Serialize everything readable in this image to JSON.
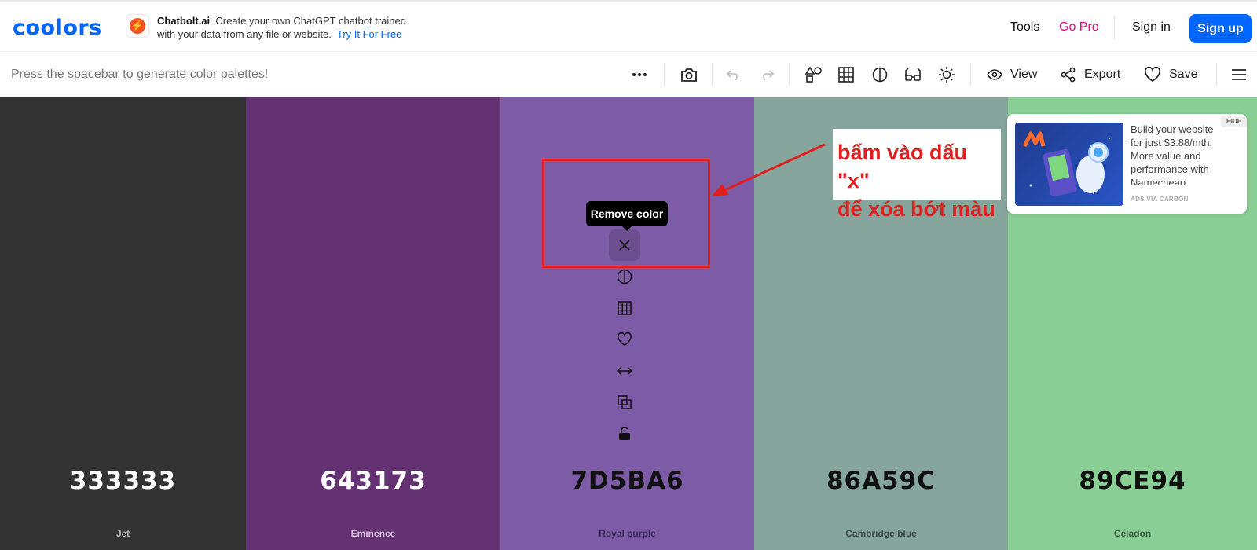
{
  "header": {
    "logo": "coolors",
    "promo": {
      "brand": "Chatbolt.ai",
      "text": "Create your own ChatGPT chatbot trained with your data from any file or website.",
      "link": "Try It For Free"
    },
    "nav": {
      "tools": "Tools",
      "go_pro": "Go Pro",
      "sign_in": "Sign in",
      "sign_up": "Sign up"
    }
  },
  "toolbar": {
    "hint": "Press the spacebar to generate color palettes!",
    "view_label": "View",
    "export_label": "Export",
    "save_label": "Save"
  },
  "palette": [
    {
      "hex": "333333",
      "name": "Jet",
      "color": "#333333",
      "text_color": "#ffffff",
      "name_color": "#bbbbbb"
    },
    {
      "hex": "643173",
      "name": "Eminence",
      "color": "#643173",
      "text_color": "#ffffff",
      "name_color": "#d5c3da"
    },
    {
      "hex": "7D5BA6",
      "name": "Royal purple",
      "color": "#7D5BA6",
      "text_color": "#111111",
      "name_color": "#3a2a52"
    },
    {
      "hex": "86A59C",
      "name": "Cambridge blue",
      "color": "#86A59C",
      "text_color": "#111111",
      "name_color": "#3c4c47"
    },
    {
      "hex": "89CE94",
      "name": "Celadon",
      "color": "#89CE94",
      "text_color": "#111111",
      "name_color": "#3d5c43"
    }
  ],
  "tooltip": "Remove color",
  "annotation": {
    "line1": "bấm vào dấu \"x\"",
    "line2": "để xóa bớt màu"
  },
  "ad": {
    "text": "Build your website for just $3.88/mth. More value and performance with Namecheap.",
    "via": "ADS VIA CARBON",
    "hide": "HIDE"
  }
}
